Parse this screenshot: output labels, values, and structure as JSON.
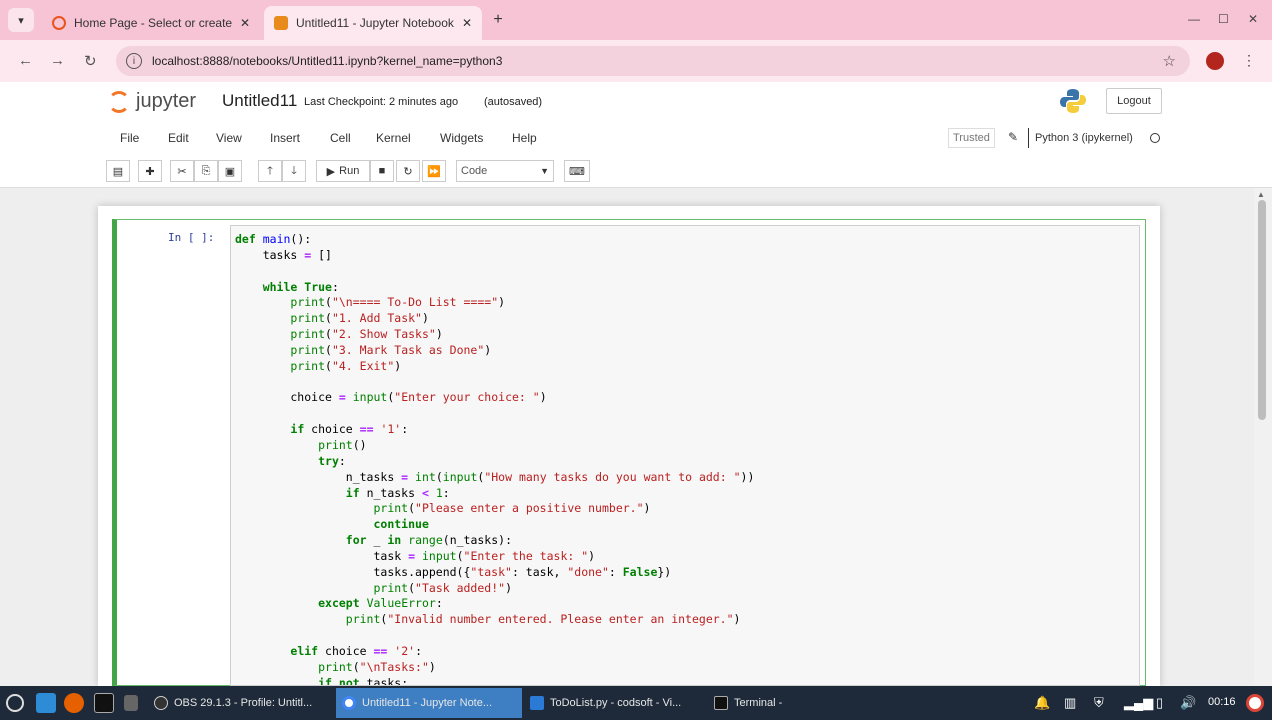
{
  "browser": {
    "tabs": [
      {
        "title": "Home Page - Select or create",
        "active": false
      },
      {
        "title": "Untitled11 - Jupyter Notebook",
        "active": true
      }
    ],
    "url": "localhost:8888/notebooks/Untitled11.ipynb?kernel_name=python3"
  },
  "jupyter": {
    "logo_text": "jupyter",
    "notebook_name": "Untitled11",
    "checkpoint": "Last Checkpoint: 2 minutes ago",
    "autosave": "(autosaved)",
    "logout_label": "Logout",
    "menu": [
      "File",
      "Edit",
      "View",
      "Insert",
      "Cell",
      "Kernel",
      "Widgets",
      "Help"
    ],
    "trusted": "Trusted",
    "kernel": "Python 3 (ipykernel)",
    "run_label": "Run",
    "cell_type": "Code"
  },
  "cell": {
    "prompt": "In [ ]:",
    "code_lines": [
      "def main():",
      "    tasks = []",
      "",
      "    while True:",
      "        print(\"\\n==== To-Do List ====\")",
      "        print(\"1. Add Task\")",
      "        print(\"2. Show Tasks\")",
      "        print(\"3. Mark Task as Done\")",
      "        print(\"4. Exit\")",
      "",
      "        choice = input(\"Enter your choice: \")",
      "",
      "        if choice == '1':",
      "            print()",
      "            try:",
      "                n_tasks = int(input(\"How many tasks do you want to add: \"))",
      "                if n_tasks < 1:",
      "                    print(\"Please enter a positive number.\")",
      "                    continue",
      "                for _ in range(n_tasks):",
      "                    task = input(\"Enter the task: \")",
      "                    tasks.append({\"task\": task, \"done\": False})",
      "                    print(\"Task added!\")",
      "            except ValueError:",
      "                print(\"Invalid number entered. Please enter an integer.\")",
      "",
      "        elif choice == '2':",
      "            print(\"\\nTasks:\")",
      "            if not tasks:"
    ]
  },
  "taskbar": {
    "items": [
      {
        "label": "OBS 29.1.3 - Profile: Untitl...",
        "active": false
      },
      {
        "label": "Untitled11 - Jupyter Note...",
        "active": true
      },
      {
        "label": "ToDoList.py - codsoft - Vi...",
        "active": false
      },
      {
        "label": "Terminal -",
        "active": false
      }
    ],
    "clock": "00:16"
  },
  "colors": {
    "accent_orange": "#f37626",
    "cell_border_green": "#42a547",
    "tab_pink": "#f6c4d5",
    "taskbar_active": "#3d7fc2"
  }
}
